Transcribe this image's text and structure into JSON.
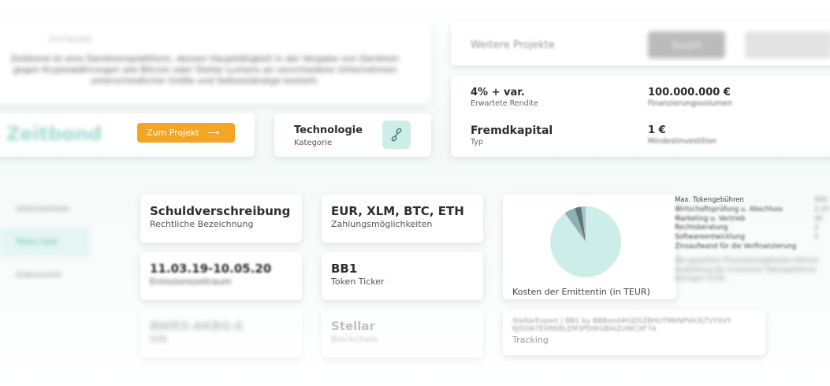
{
  "intro": {
    "heading": "ZEITBOND",
    "text": "Zeitbond ist eine Darlehensplattform, dessen Haupttätigkeit in der Vergabe von Darlehen gegen Kryptowährungen wie Bitcoin oder Stellar Lumens an verschiedene Unternehmen unterschiedlicher Größe und Selbstständige besteht."
  },
  "logo": "Zeitbond",
  "cta": {
    "label": "Zum Projekt",
    "arrow": "⟶"
  },
  "category": {
    "value": "Technologie",
    "label": "Kategorie",
    "icon": "link-icon"
  },
  "weitere": {
    "label": "Weitere Projekte",
    "button1": "Favorit"
  },
  "stats": {
    "rendite": {
      "value": "4% + var.",
      "label": "Erwartete Rendite"
    },
    "volumen": {
      "value": "100.000.000 €",
      "label": "Finanzierungsvolumen"
    },
    "typ": {
      "value": "Fremdkapital",
      "label": "Typ"
    },
    "mindest": {
      "value": "1 €",
      "label": "Mindestinvestition"
    }
  },
  "sidebar": {
    "items": [
      {
        "label": "Unternehmen"
      },
      {
        "label": "Token Sale"
      },
      {
        "label": "Dokumente"
      }
    ]
  },
  "info": {
    "bezeichnung": {
      "value": "Schuldverschreibung",
      "label": "Rechtliche Bezeichnung"
    },
    "zahlung": {
      "value": "EUR, XLM, BTC, ETH",
      "label": "Zahlungsmöglichkeiten"
    },
    "zeitraum": {
      "value": "11.03.19-10.05.20",
      "label": "Emissionszeitraum"
    },
    "ticker": {
      "value": "BB1",
      "label": "Token Ticker"
    },
    "wkn": {
      "value": "BWR5-AKBG-X",
      "label": "ISIN"
    },
    "blockchain": {
      "value": "Stellar",
      "label": "Blockchain"
    }
  },
  "chart": {
    "label": "Kosten der Emittentin (in TEUR)",
    "colors": [
      "#cdeee8",
      "#8fb1b4",
      "#5f7479",
      "#a8c4c6"
    ]
  },
  "chart_data": {
    "type": "pie",
    "labels": [
      "Max. Tokengebühren",
      "Wirtschaftsprüfung u. Rechtsberatung",
      "Marketing u. Vertrieb",
      "Rechtsberatung"
    ],
    "values": [
      90,
      5,
      3,
      2
    ]
  },
  "legend": {
    "items": [
      {
        "name": "Max. Tokengebühren",
        "value": "500"
      },
      {
        "name": "Wirtschaftsprüfung u. Abschluss",
        "value": "2.10"
      },
      {
        "name": "Marketing u. Vertrieb",
        "value": "40"
      },
      {
        "name": "Rechtsberatung",
        "value": "2"
      },
      {
        "name": "Softwareentwicklung",
        "value": "5"
      },
      {
        "name": "Zinsaufwand für die Verfinanzierung",
        "value": ""
      }
    ],
    "note": "Die gesamten Finanzierungskosten können Ausbildung der Investoren Tokengebühren betragen 575€..."
  },
  "tracking": {
    "line1": "StellarExpert | BB1 by BBBond#GD5ZBHUTMKNPVA3LTVYXVY",
    "line2": "6J5SW7EXRKBLEM3PDIKGBAIZUWCXF74",
    "label": "Tracking"
  }
}
